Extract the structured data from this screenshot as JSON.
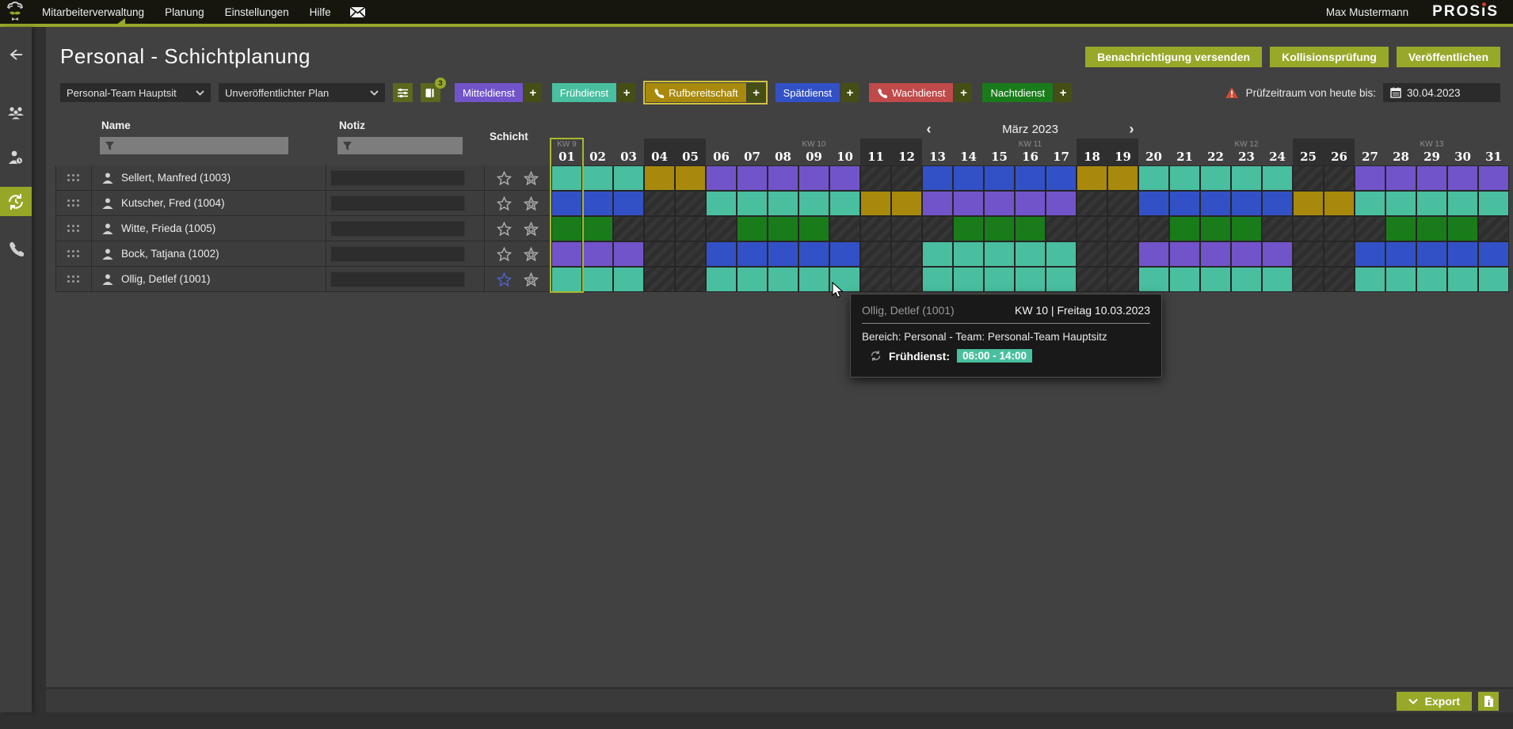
{
  "topbar": {
    "menu": [
      "Mitarbeiterverwaltung",
      "Planung",
      "Einstellungen",
      "Hilfe"
    ],
    "active_menu": "Mitarbeiterverwaltung",
    "user": "Max Mustermann",
    "brand_left": "PROS",
    "brand_i": "ı",
    "brand_right": "S"
  },
  "sidebar": {
    "icons": [
      "back",
      "team",
      "person-clock",
      "shift-plan",
      "phone"
    ],
    "active": "shift-plan"
  },
  "page": {
    "title": "Personal - Schichtplanung"
  },
  "actions": [
    "Benachrichtigung versenden",
    "Kollisionsprüfung",
    "Veröffentlichen"
  ],
  "filters": {
    "team": "Personal-Team Hauptsit",
    "plan": "Unveröffentlichter Plan",
    "plan_badge": "3"
  },
  "shift_types": [
    {
      "code": "M",
      "label": "Mitteldienst",
      "color": "#7254ca",
      "phone": false,
      "selected": false
    },
    {
      "code": "F",
      "label": "Frühdienst",
      "color": "#49bfa0",
      "phone": false,
      "selected": false
    },
    {
      "code": "R",
      "label": "Rufbereitschaft",
      "color": "#a8890b",
      "phone": true,
      "selected": true
    },
    {
      "code": "S",
      "label": "Spätdienst",
      "color": "#3351c6",
      "phone": false,
      "selected": false
    },
    {
      "code": "W",
      "label": "Wachdienst",
      "color": "#c04a4a",
      "phone": true,
      "selected": false
    },
    {
      "code": "N",
      "label": "Nachtdienst",
      "color": "#1a7b1b",
      "phone": false,
      "selected": false
    }
  ],
  "shift_colors": {
    "M": "#7254ca",
    "F": "#49bfa0",
    "S": "#3351c6",
    "R": "#a8890b",
    "N": "#1a7b1b",
    "W": "#c04a4a"
  },
  "period": {
    "label": "Prüfzeitraum von heute bis:",
    "date": "30.04.2023"
  },
  "table": {
    "name_header": "Name",
    "note_header": "Notiz",
    "shift_header": "Schicht"
  },
  "calendar": {
    "month": "März 2023",
    "prev": "‹",
    "next": "›",
    "week_labels": {
      "1": "KW 9",
      "9": "KW 10",
      "16": "KW 11",
      "23": "KW 12",
      "29": "KW 13"
    },
    "weekend_days": [
      4,
      5,
      11,
      12,
      18,
      19,
      25,
      26
    ],
    "today_day": 1,
    "num_days": 31
  },
  "employees": [
    {
      "name": "Sellert, Manfred (1003)",
      "note": "",
      "star1": "normal",
      "shifts": [
        "F",
        "F",
        "F",
        "R",
        "R",
        "M",
        "M",
        "M",
        "M",
        "M",
        "",
        "",
        "S",
        "S",
        "S",
        "S",
        "S",
        "R",
        "R",
        "F",
        "F",
        "F",
        "F",
        "F",
        "",
        "",
        "M",
        "M",
        "M",
        "M",
        "M"
      ]
    },
    {
      "name": "Kutscher, Fred (1004)",
      "note": "",
      "star1": "normal",
      "shifts": [
        "S",
        "S",
        "S",
        "",
        "",
        "F",
        "F",
        "F",
        "F",
        "F",
        "R",
        "R",
        "M",
        "M",
        "M",
        "M",
        "M",
        "",
        "",
        "S",
        "S",
        "S",
        "S",
        "S",
        "R",
        "R",
        "F",
        "F",
        "F",
        "F",
        "F"
      ]
    },
    {
      "name": "Witte, Frieda (1005)",
      "note": "",
      "star1": "normal",
      "shifts": [
        "N",
        "N",
        "",
        "",
        "",
        "",
        "N",
        "N",
        "N",
        "",
        "",
        "",
        "",
        "N",
        "N",
        "N",
        "",
        "",
        "",
        "",
        "N",
        "N",
        "N",
        "",
        "",
        "",
        "",
        "N",
        "N",
        "N",
        ""
      ]
    },
    {
      "name": "Bock, Tatjana (1002)",
      "note": "",
      "star1": "normal",
      "shifts": [
        "M",
        "M",
        "M",
        "",
        "",
        "S",
        "S",
        "S",
        "S",
        "S",
        "",
        "",
        "F",
        "F",
        "F",
        "F",
        "F",
        "",
        "",
        "M",
        "M",
        "M",
        "M",
        "M",
        "",
        "",
        "S",
        "S",
        "S",
        "S",
        "S"
      ]
    },
    {
      "name": "Ollig, Detlef (1001)",
      "note": "",
      "star1": "active",
      "shifts": [
        "F",
        "F",
        "F",
        "",
        "",
        "F",
        "F",
        "F",
        "F",
        "F",
        "",
        "",
        "F",
        "F",
        "F",
        "F",
        "F",
        "",
        "",
        "F",
        "F",
        "F",
        "F",
        "F",
        "",
        "",
        "F",
        "F",
        "F",
        "F",
        "F"
      ]
    }
  ],
  "tooltip": {
    "name": "Ollig, Detlef (1001)",
    "week": "KW 10 | Freitag 10.03.2023",
    "line": "Bereich: Personal - Team: Personal-Team Hauptsitz",
    "shift_label": "Frühdienst:",
    "time": "06:00 - 14:00",
    "time_color": "#4abf9f"
  },
  "export": {
    "label": "Export"
  }
}
